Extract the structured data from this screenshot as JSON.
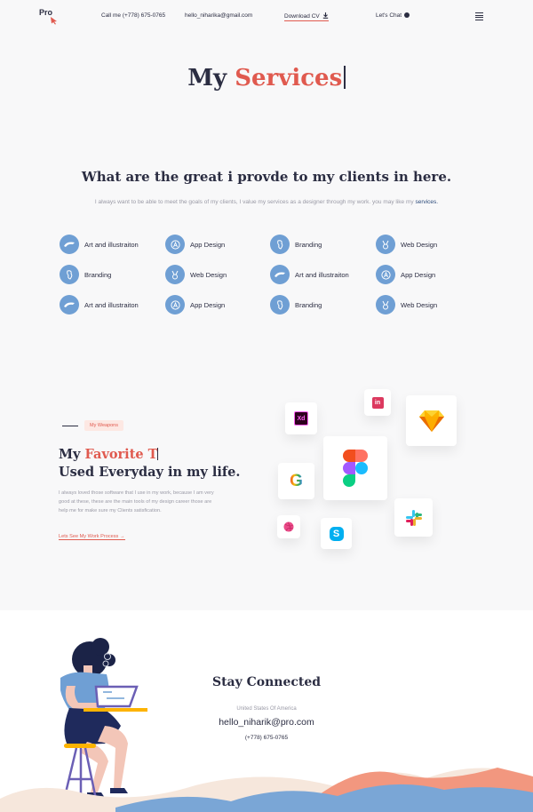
{
  "header": {
    "logo": "Pro",
    "phone": "Call me (+778) 675-0765",
    "email": "hello_niharika@gmail.com",
    "download_cv": "Download CV",
    "chat": "Let's Chat"
  },
  "hero": {
    "title_dark": "My",
    "title_accent": "Services"
  },
  "services_section": {
    "heading": "What are the great  i provde to my clients in here.",
    "description": "I always want to be able to meet the goals of my clients, I value my services as a designer through my work. you may like my",
    "description_link": "services.",
    "items": [
      {
        "label": "Art and illustraiton",
        "icon": "illustration-icon"
      },
      {
        "label": "App Design",
        "icon": "app-store-icon"
      },
      {
        "label": "Branding",
        "icon": "branding-icon"
      },
      {
        "label": "Web Design",
        "icon": "web-design-icon"
      },
      {
        "label": "Branding",
        "icon": "branding-icon"
      },
      {
        "label": "Web Design",
        "icon": "web-design-icon"
      },
      {
        "label": "Art and illustraiton",
        "icon": "illustration-icon"
      },
      {
        "label": "App Design",
        "icon": "app-store-icon"
      },
      {
        "label": "Art and illustraiton",
        "icon": "illustration-icon"
      },
      {
        "label": "App Design",
        "icon": "app-store-icon"
      },
      {
        "label": "Branding",
        "icon": "branding-icon"
      },
      {
        "label": "Web Design",
        "icon": "web-design-icon"
      }
    ]
  },
  "weapons": {
    "badge": "My Weapons",
    "title_dark": "My",
    "title_accent": "Favorite T",
    "title_line2": "Used Everyday in my life.",
    "description": "I always loved those software that I use in my work, because I am very good at these, these are the main tools of my design career those are help me for make sure my Clients satisfication.",
    "link": "Lets See My Work Process",
    "tools": {
      "xd": "Xd",
      "invision": "in",
      "google": "G"
    }
  },
  "footer": {
    "title": "Stay Connected",
    "country": "United States Of America",
    "email": "hello_niharik@pro.com",
    "phone": "(+778) 675-0765"
  },
  "colors": {
    "accent": "#e05a4f",
    "dark": "#2b2d42",
    "icon_blue": "#6f9fd4",
    "muted": "#9a9aa6"
  }
}
